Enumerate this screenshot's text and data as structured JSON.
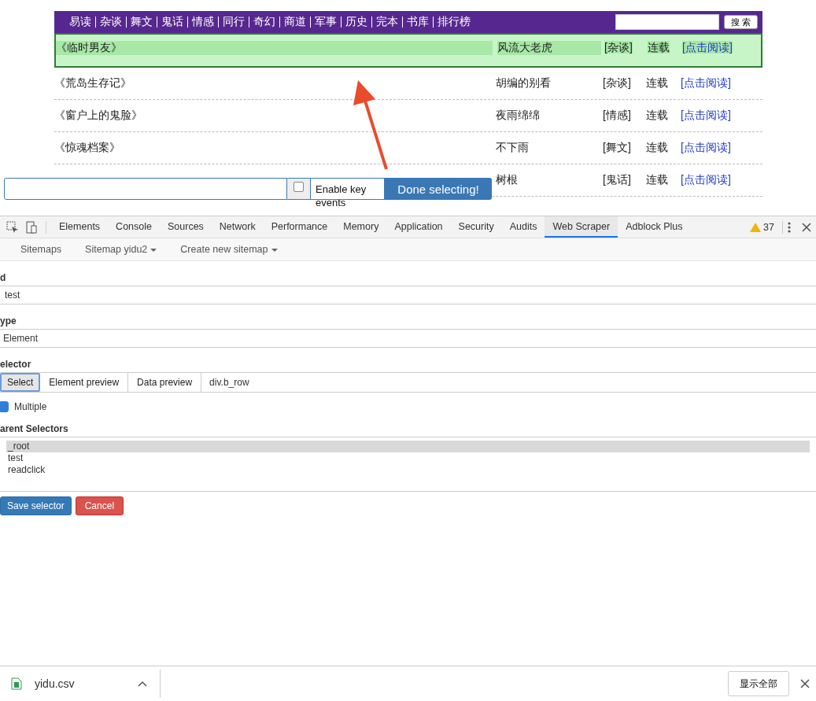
{
  "site_nav": {
    "links": [
      "易读",
      "杂谈",
      "舞文",
      "鬼话",
      "情感",
      "同行",
      "奇幻",
      "商道",
      "军事",
      "历史",
      "完本",
      "书库",
      "排行榜"
    ],
    "search_button": "搜 索"
  },
  "book_rows": [
    {
      "title": "《临时男友》",
      "author": "风流大老虎",
      "category": "[杂谈]",
      "status": "连载",
      "link": "[点击阅读]",
      "selected": true
    },
    {
      "title": "《荒岛生存记》",
      "author": "胡编的别看",
      "category": "[杂谈]",
      "status": "连载",
      "link": "[点击阅读]",
      "selected": false
    },
    {
      "title": "《窗户上的鬼脸》",
      "author": "夜雨绵绵",
      "category": "[情感]",
      "status": "连载",
      "link": "[点击阅读]",
      "selected": false
    },
    {
      "title": "《惊魂档案》",
      "author": "不下雨",
      "category": "[舞文]",
      "status": "连载",
      "link": "[点击阅读]",
      "selected": false
    },
    {
      "author": "树根",
      "category": "[鬼话]",
      "status": "连载",
      "link": "[点击阅读]",
      "selected": false
    }
  ],
  "selection_bar": {
    "enable_key_checked": false,
    "enable_key_label": "Enable key events",
    "done_button": "Done selecting!"
  },
  "devtools": {
    "tabs": [
      {
        "label": "Elements",
        "selected": false
      },
      {
        "label": "Console",
        "selected": false
      },
      {
        "label": "Sources",
        "selected": false
      },
      {
        "label": "Network",
        "selected": false
      },
      {
        "label": "Performance",
        "selected": false
      },
      {
        "label": "Memory",
        "selected": false
      },
      {
        "label": "Application",
        "selected": false
      },
      {
        "label": "Security",
        "selected": false
      },
      {
        "label": "Audits",
        "selected": false
      },
      {
        "label": "Web Scraper",
        "selected": true
      },
      {
        "label": "Adblock Plus",
        "selected": false
      }
    ],
    "warning_count": "37",
    "subnav": [
      "Sitemaps",
      "Sitemap yidu2",
      "Create new sitemap"
    ]
  },
  "form": {
    "id_label": "d",
    "id_value": "test",
    "type_label": "ype",
    "type_value": "Element",
    "selector_label": "elector",
    "selector_buttons": [
      {
        "label": "Select",
        "selected": true
      },
      {
        "label": "Element preview",
        "selected": false
      },
      {
        "label": "Data preview",
        "selected": false
      }
    ],
    "selector_value": "div.b_row",
    "multiple_label": "Multiple",
    "multiple_checked": true,
    "parent_label": "arent Selectors",
    "parent_selectors": [
      {
        "label": "_root",
        "selected": true
      },
      {
        "label": "test",
        "selected": false
      },
      {
        "label": "readclick",
        "selected": false
      }
    ],
    "save_button": "Save selector",
    "cancel_button": "Cancel"
  },
  "download_bar": {
    "file": "yidu.csv",
    "show_all": "显示全部"
  }
}
